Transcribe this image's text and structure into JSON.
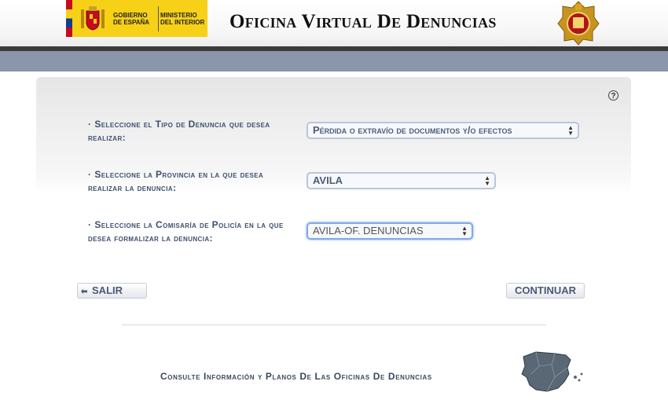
{
  "header": {
    "gov_line1": "GOBIERNO",
    "gov_line2": "DE ESPAÑA",
    "min_line1": "MINISTERIO",
    "min_line2": "DEL INTERIOR",
    "title": "Oficina Virtual De Denuncias"
  },
  "form": {
    "type_label": "Seleccione el Tipo de Denuncia que desea realizar:",
    "type_value": "Pérdida o extravío de documentos y/o efectos",
    "province_label": "Seleccione la Provincia en la que desea realizar la denuncia:",
    "province_value": "AVILA",
    "station_label": "Seleccione la Comisaría de Policía en la que desea formalizar la denuncia:",
    "station_value": "AVILA-OF. DENUNCIAS",
    "help": "?"
  },
  "buttons": {
    "exit_arrow": "⬅",
    "exit": "SALIR",
    "continue": "CONTINUAR"
  },
  "footer": {
    "link": "Consulte Información y Planos De Las Oficinas De Denuncias"
  },
  "colors": {
    "band": "#8a97ab",
    "label": "#3d4f6b",
    "gov_yellow": "#f7d117"
  }
}
